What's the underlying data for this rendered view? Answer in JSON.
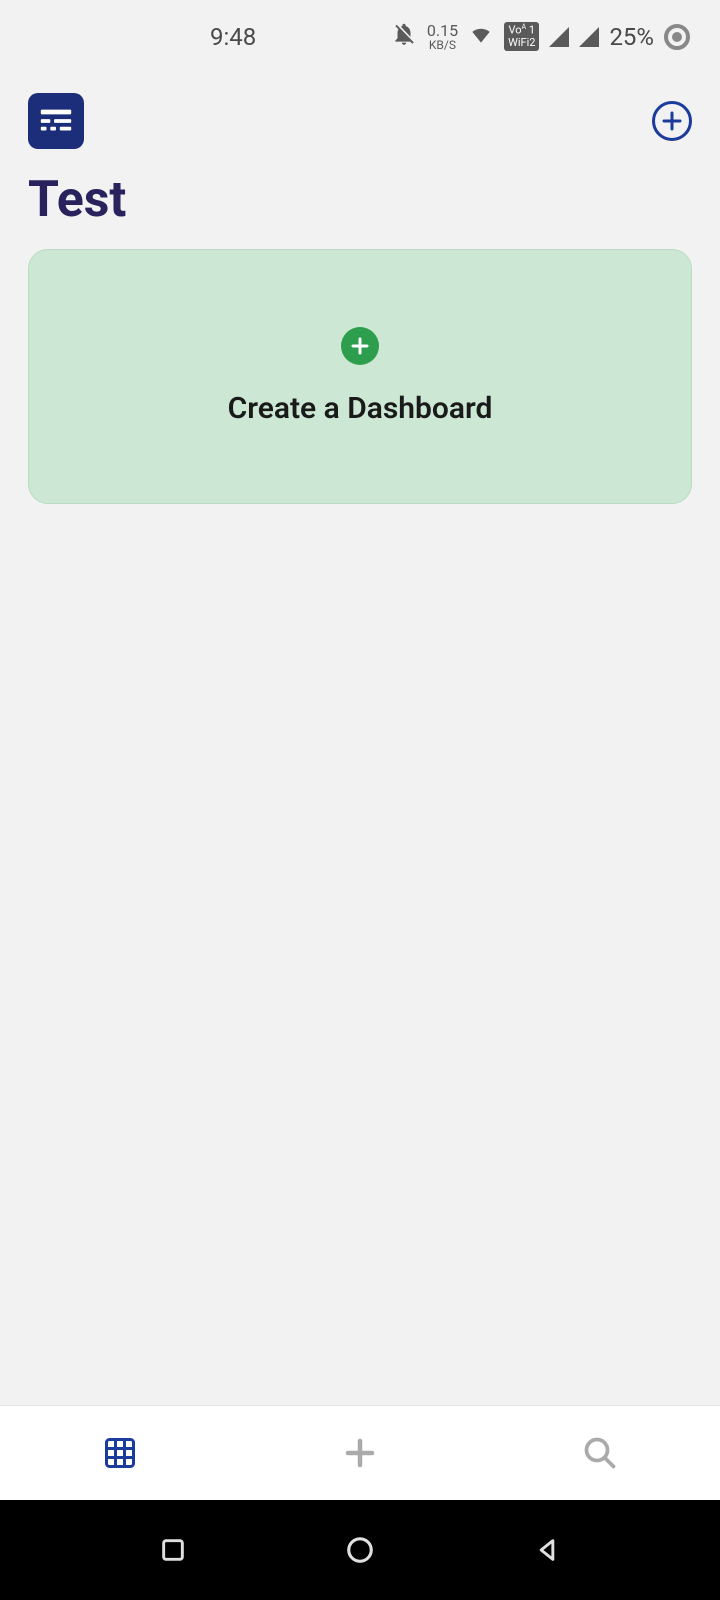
{
  "status_bar": {
    "time": "9:48",
    "data_speed_value": "0.15",
    "data_speed_unit": "KB/S",
    "vowifi": "Vo\nWiFi2",
    "battery": "25%"
  },
  "header": {
    "add_icon_label": "+"
  },
  "page": {
    "title": "Test"
  },
  "create_card": {
    "plus_label": "+",
    "label": "Create a Dashboard"
  },
  "colors": {
    "primary": "#1c2e7a",
    "accent_green": "#2d9d4e",
    "card_bg": "#cce8d4"
  }
}
